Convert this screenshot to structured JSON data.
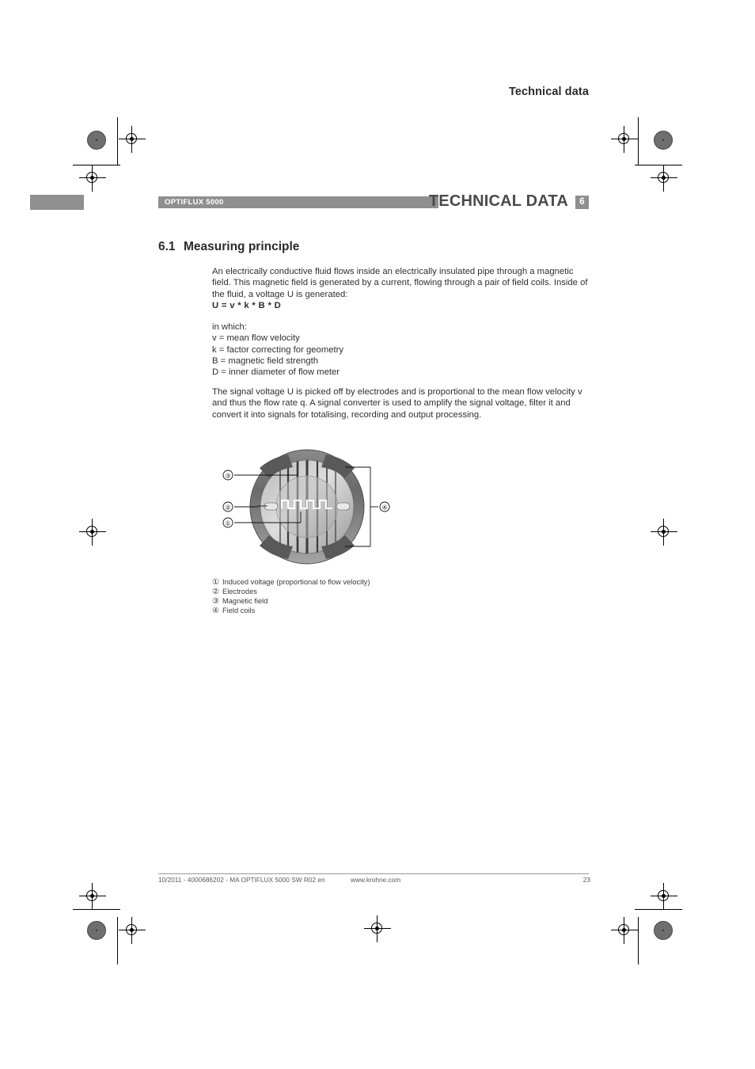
{
  "running_head": "Technical data",
  "chapter_band": {
    "product": "OPTIFLUX 5000",
    "title": "TECHNICAL DATA",
    "chapter_number": "6",
    "band_color": "#8f8f8f",
    "title_color": "#4a4a4a"
  },
  "section": {
    "number": "6.1",
    "title": "Measuring principle"
  },
  "paragraphs": {
    "intro": "An electrically conductive fluid flows inside an electrically insulated pipe through a magnetic field. This magnetic field is generated by a current, flowing through a pair of field coils. Inside of the fluid, a voltage U is generated:",
    "formula": "U = v * k * B * D",
    "in_which_label": "in which:",
    "definitions": [
      "v = mean flow velocity",
      "k = factor correcting for geometry",
      "B = magnetic field strength",
      "D = inner diameter of flow meter"
    ],
    "closing": "The signal voltage U is picked off by electrodes and is proportional to the mean flow velocity v and thus the flow rate q. A signal converter is used to amplify the signal voltage, filter it and convert it into signals for totalising, recording and output processing."
  },
  "figure": {
    "callouts": [
      "③",
      "②",
      "①",
      "④"
    ],
    "colors": {
      "outer_ring": "#6f6f6f",
      "coil_arc": "#595959",
      "pipe_body_light": "#d4d4d4",
      "pipe_body_mid": "#a8a8a8",
      "field_line": "#3a3a3a",
      "signal_trace": "#ffffff",
      "electrode": "#e8e8e8"
    }
  },
  "legend": [
    {
      "marker": "①",
      "text": "Induced voltage (proportional to flow velocity)"
    },
    {
      "marker": "②",
      "text": "Electrodes"
    },
    {
      "marker": "③",
      "text": "Magnetic field"
    },
    {
      "marker": "④",
      "text": "Field coils"
    }
  ],
  "footer": {
    "left": "10/2011 - 4000686202 - MA OPTIFLUX 5000 SW R02 en",
    "center": "www.krohne.com",
    "page": "23"
  }
}
